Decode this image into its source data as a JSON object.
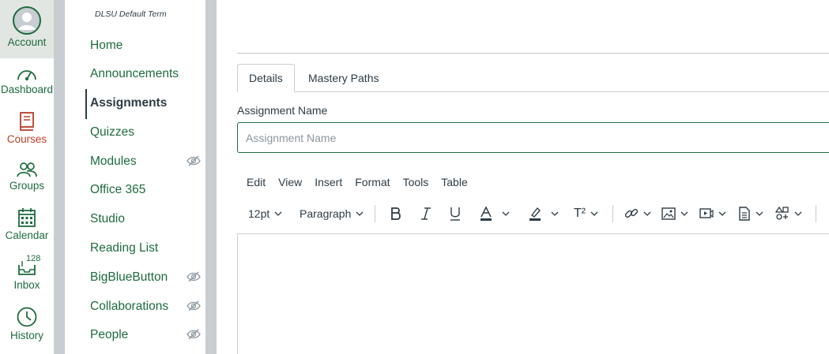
{
  "global_nav": {
    "account": "Account",
    "dashboard": "Dashboard",
    "courses": "Courses",
    "groups": "Groups",
    "calendar": "Calendar",
    "inbox": "Inbox",
    "inbox_count": "128",
    "history": "History"
  },
  "course_nav": {
    "term": "DLSU Default Term",
    "items": [
      {
        "label": "Home"
      },
      {
        "label": "Announcements"
      },
      {
        "label": "Assignments"
      },
      {
        "label": "Quizzes"
      },
      {
        "label": "Modules"
      },
      {
        "label": "Office 365"
      },
      {
        "label": "Studio"
      },
      {
        "label": "Reading List"
      },
      {
        "label": "BigBlueButton"
      },
      {
        "label": "Collaborations"
      },
      {
        "label": "People"
      }
    ]
  },
  "tabs": {
    "details": "Details",
    "mastery_paths": "Mastery Paths"
  },
  "form": {
    "name_label": "Assignment Name",
    "name_placeholder": "Assignment Name",
    "name_value": ""
  },
  "editor": {
    "menu": [
      "Edit",
      "View",
      "Insert",
      "Format",
      "Tools",
      "Table"
    ],
    "font_size": "12pt",
    "block_format": "Paragraph",
    "superscript_label": "T²"
  },
  "colors": {
    "brand": "#1e6b3e",
    "courses": "#b83e27",
    "text": "#2d3b45",
    "border": "#c7cdd1"
  }
}
